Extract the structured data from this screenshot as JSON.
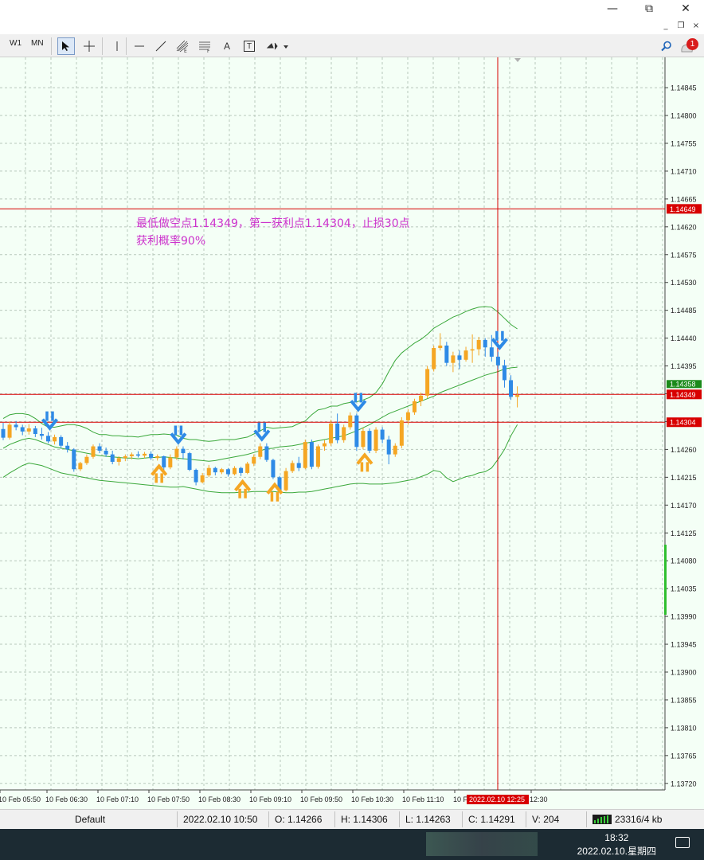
{
  "window": {
    "controls": {
      "minimize": "—",
      "maximize": "⧉",
      "close": "✕"
    },
    "mdi_controls": {
      "minimize": "_",
      "restore": "❐",
      "close": "×"
    }
  },
  "toolbar": {
    "timeframes": [
      "W1",
      "MN"
    ],
    "tools": [
      "cursor-icon",
      "crosshair-icon",
      "vertical-line-icon",
      "horizontal-line-icon",
      "trendline-icon",
      "fibonacci-icon",
      "channel-icon",
      "text-icon",
      "text-label-icon",
      "arrows-icon"
    ],
    "text_tool_label": "A",
    "text_label_tool_label": "T",
    "notification_badge": "1"
  },
  "colors": {
    "background": "#f4fff6",
    "grid": "#b8c8bc",
    "bull": "#f5a623",
    "bear": "#2e8ae6",
    "band": "#3aa83a",
    "level_line": "#d80000",
    "annotation": "#cc33cc"
  },
  "annotation": {
    "line1": "最低做空点1.14349，第一获利点1.14304，止损30点",
    "line2": "获利概率90%"
  },
  "chart_data": {
    "type": "candlestick",
    "symbol_timeframe": "M5",
    "price_axis": {
      "ticks": [
        1.14845,
        1.148,
        1.14755,
        1.1471,
        1.14665,
        1.1462,
        1.14575,
        1.1453,
        1.14485,
        1.1444,
        1.14395,
        1.1435,
        1.14305,
        1.1426,
        1.14215,
        1.1417,
        1.14125,
        1.1408,
        1.14035,
        1.1399,
        1.13945,
        1.139,
        1.13855,
        1.1381,
        1.13765,
        1.1372
      ],
      "range": [
        1.13712,
        1.14867
      ]
    },
    "time_axis": {
      "labels": [
        "10 Feb 05:50",
        "10 Feb 06:30",
        "10 Feb 07:10",
        "10 Feb 07:50",
        "10 Feb 08:30",
        "10 Feb 09:10",
        "10 Feb 09:50",
        "10 Feb 10:30",
        "10 Feb 11:10",
        "10 F",
        "12:30"
      ],
      "crosshair_label": "2022.02.10 12:25"
    },
    "horizontal_levels": [
      {
        "price": 1.14649,
        "label": "1.14649"
      },
      {
        "price": 1.14349,
        "label": "1.14349"
      },
      {
        "price": 1.14304,
        "label": "1.14304"
      }
    ],
    "current_price_label": "1.14358",
    "candles": [
      [
        1.14293,
        1.14303,
        1.14275,
        1.14279
      ],
      [
        1.14279,
        1.14305,
        1.14276,
        1.143
      ],
      [
        1.143,
        1.14306,
        1.14291,
        1.14296
      ],
      [
        1.14296,
        1.143,
        1.14283,
        1.14289
      ],
      [
        1.14289,
        1.14301,
        1.14284,
        1.14294
      ],
      [
        1.14294,
        1.14298,
        1.1428,
        1.14285
      ],
      [
        1.14285,
        1.14295,
        1.14276,
        1.14282
      ],
      [
        1.14282,
        1.14288,
        1.1427,
        1.14273
      ],
      [
        1.14273,
        1.14284,
        1.14268,
        1.1428
      ],
      [
        1.1428,
        1.14283,
        1.14262,
        1.14266
      ],
      [
        1.14266,
        1.14272,
        1.14255,
        1.1426
      ],
      [
        1.1426,
        1.14262,
        1.14224,
        1.14228
      ],
      [
        1.14228,
        1.1424,
        1.14225,
        1.14238
      ],
      [
        1.14238,
        1.14252,
        1.14235,
        1.14248
      ],
      [
        1.14248,
        1.14268,
        1.14245,
        1.14265
      ],
      [
        1.14265,
        1.1427,
        1.14254,
        1.14258
      ],
      [
        1.14258,
        1.14263,
        1.14248,
        1.14252
      ],
      [
        1.14252,
        1.14258,
        1.14236,
        1.1424
      ],
      [
        1.1424,
        1.14249,
        1.14234,
        1.14246
      ],
      [
        1.14246,
        1.14252,
        1.14241,
        1.14249
      ],
      [
        1.14249,
        1.14255,
        1.14244,
        1.14252
      ],
      [
        1.14252,
        1.14257,
        1.14247,
        1.1425
      ],
      [
        1.1425,
        1.14256,
        1.14246,
        1.14253
      ],
      [
        1.14253,
        1.14257,
        1.14243,
        1.14246
      ],
      [
        1.14246,
        1.14252,
        1.14242,
        1.14249
      ],
      [
        1.14249,
        1.1425,
        1.14226,
        1.14231
      ],
      [
        1.14231,
        1.14252,
        1.14228,
        1.14247
      ],
      [
        1.14247,
        1.14265,
        1.14243,
        1.14261
      ],
      [
        1.14261,
        1.14265,
        1.14244,
        1.14254
      ],
      [
        1.14254,
        1.14256,
        1.14225,
        1.14227
      ],
      [
        1.14227,
        1.14229,
        1.14202,
        1.14207
      ],
      [
        1.14207,
        1.14222,
        1.14205,
        1.14218
      ],
      [
        1.14218,
        1.14235,
        1.14215,
        1.1423
      ],
      [
        1.1423,
        1.14232,
        1.14218,
        1.14223
      ],
      [
        1.14223,
        1.1423,
        1.1422,
        1.14228
      ],
      [
        1.14228,
        1.1423,
        1.14216,
        1.1422
      ],
      [
        1.1422,
        1.14233,
        1.14218,
        1.1423
      ],
      [
        1.1423,
        1.14232,
        1.14217,
        1.14222
      ],
      [
        1.14222,
        1.1424,
        1.1422,
        1.14237
      ],
      [
        1.14237,
        1.14252,
        1.14233,
        1.14248
      ],
      [
        1.14248,
        1.1427,
        1.14244,
        1.14265
      ],
      [
        1.14265,
        1.1427,
        1.1424,
        1.14243
      ],
      [
        1.14243,
        1.14245,
        1.14212,
        1.14215
      ],
      [
        1.14215,
        1.14217,
        1.1419,
        1.14194
      ],
      [
        1.14194,
        1.1423,
        1.14192,
        1.14225
      ],
      [
        1.14225,
        1.14242,
        1.14222,
        1.14238
      ],
      [
        1.14238,
        1.14248,
        1.14225,
        1.1423
      ],
      [
        1.1423,
        1.14276,
        1.14228,
        1.14272
      ],
      [
        1.14272,
        1.14276,
        1.14228,
        1.14232
      ],
      [
        1.14232,
        1.14268,
        1.14229,
        1.14265
      ],
      [
        1.14265,
        1.14275,
        1.14258,
        1.1427
      ],
      [
        1.1427,
        1.14308,
        1.14266,
        1.14302
      ],
      [
        1.14302,
        1.14318,
        1.1427,
        1.14275
      ],
      [
        1.14275,
        1.143,
        1.14271,
        1.14296
      ],
      [
        1.14296,
        1.1432,
        1.14292,
        1.14315
      ],
      [
        1.14315,
        1.14318,
        1.14258,
        1.14264
      ],
      [
        1.14264,
        1.14295,
        1.1426,
        1.1429
      ],
      [
        1.1429,
        1.14294,
        1.14254,
        1.14258
      ],
      [
        1.14258,
        1.14296,
        1.14254,
        1.14292
      ],
      [
        1.14292,
        1.14296,
        1.1427,
        1.14276
      ],
      [
        1.14276,
        1.14282,
        1.14236,
        1.14252
      ],
      [
        1.14252,
        1.1427,
        1.14248,
        1.14266
      ],
      [
        1.14266,
        1.14312,
        1.14262,
        1.14307
      ],
      [
        1.14307,
        1.14325,
        1.143,
        1.1432
      ],
      [
        1.1432,
        1.14342,
        1.14316,
        1.14338
      ],
      [
        1.14338,
        1.14352,
        1.1433,
        1.14347
      ],
      [
        1.14347,
        1.14395,
        1.14343,
        1.1439
      ],
      [
        1.1439,
        1.14428,
        1.14386,
        1.14424
      ],
      [
        1.14424,
        1.14448,
        1.1442,
        1.14428
      ],
      [
        1.14428,
        1.14434,
        1.14395,
        1.144
      ],
      [
        1.144,
        1.14418,
        1.14385,
        1.14412
      ],
      [
        1.14412,
        1.1442,
        1.1439,
        1.14405
      ],
      [
        1.14405,
        1.14426,
        1.14402,
        1.1442
      ],
      [
        1.1442,
        1.14446,
        1.144,
        1.14422
      ],
      [
        1.14422,
        1.14442,
        1.14412,
        1.14437
      ],
      [
        1.14437,
        1.1444,
        1.1441,
        1.14425
      ],
      [
        1.14425,
        1.14445,
        1.14402,
        1.1441
      ],
      [
        1.1441,
        1.14418,
        1.1439,
        1.14396
      ],
      [
        1.14396,
        1.14405,
        1.1436,
        1.14372
      ],
      [
        1.14372,
        1.1438,
        1.1434,
        1.14345
      ],
      [
        1.14345,
        1.14362,
        1.14328,
        1.14348
      ]
    ],
    "bands": {
      "upper": [
        1.1431,
        1.14316,
        1.14318,
        1.14318,
        1.14316,
        1.1431,
        1.14302,
        1.14296,
        1.14296,
        1.14298,
        1.143,
        1.143,
        1.14298,
        1.14294,
        1.14288,
        1.14284,
        1.14284,
        1.14282,
        1.14282,
        1.14281,
        1.14281,
        1.1428,
        1.14282,
        1.14284,
        1.14284,
        1.14285,
        1.14284,
        1.14283,
        1.14278,
        1.14276,
        1.14276,
        1.14274,
        1.14273,
        1.14274,
        1.14276,
        1.14276,
        1.14276,
        1.14278,
        1.1428,
        1.14285,
        1.1429,
        1.14296,
        1.14294,
        1.14295,
        1.14296,
        1.14297,
        1.14302,
        1.14306,
        1.14316,
        1.14324,
        1.14326,
        1.1433,
        1.1433,
        1.14334,
        1.14336,
        1.14337,
        1.1434,
        1.14344,
        1.14352,
        1.14366,
        1.14386,
        1.14404,
        1.14416,
        1.14424,
        1.14432,
        1.14438,
        1.14446,
        1.14456,
        1.14462,
        1.14468,
        1.14474,
        1.14478,
        1.14483,
        1.14487,
        1.1449,
        1.14491,
        1.1449,
        1.14482,
        1.14472,
        1.14462,
        1.14455
      ],
      "middle": [
        1.14262,
        1.14268,
        1.14272,
        1.14276,
        1.14278,
        1.14276,
        1.14272,
        1.14268,
        1.14264,
        1.14262,
        1.1426,
        1.14258,
        1.14256,
        1.14254,
        1.14252,
        1.1425,
        1.14249,
        1.14248,
        1.14247,
        1.14246,
        1.14246,
        1.14245,
        1.14246,
        1.14247,
        1.14247,
        1.14248,
        1.14247,
        1.14246,
        1.14245,
        1.14244,
        1.14243,
        1.14242,
        1.14241,
        1.14242,
        1.14244,
        1.14246,
        1.14248,
        1.1425,
        1.14252,
        1.14255,
        1.14258,
        1.14261,
        1.14262,
        1.14264,
        1.14265,
        1.14266,
        1.14268,
        1.1427,
        1.14272,
        1.14274,
        1.14276,
        1.14278,
        1.1428,
        1.14282,
        1.14286,
        1.1429,
        1.14295,
        1.143,
        1.14306,
        1.14312,
        1.14318,
        1.14322,
        1.14326,
        1.1433,
        1.14334,
        1.14338,
        1.14342,
        1.14346,
        1.14352,
        1.14356,
        1.1436,
        1.14364,
        1.14368,
        1.14372,
        1.14376,
        1.1438,
        1.14383,
        1.14386,
        1.1439,
        1.14392,
        1.14393
      ],
      "lower": [
        1.14215,
        1.14222,
        1.14228,
        1.14234,
        1.14238,
        1.14236,
        1.14234,
        1.1423,
        1.14226,
        1.14222,
        1.1422,
        1.14218,
        1.14216,
        1.14214,
        1.14212,
        1.1421,
        1.14209,
        1.14208,
        1.14207,
        1.14206,
        1.14205,
        1.14204,
        1.14203,
        1.14202,
        1.14201,
        1.142,
        1.14199,
        1.14199,
        1.142,
        1.14198,
        1.14196,
        1.14194,
        1.14192,
        1.14191,
        1.1419,
        1.1419,
        1.1419,
        1.14191,
        1.14191,
        1.14192,
        1.14192,
        1.14192,
        1.14192,
        1.14191,
        1.1419,
        1.1419,
        1.14191,
        1.14191,
        1.14192,
        1.14194,
        1.14196,
        1.14198,
        1.142,
        1.14202,
        1.14204,
        1.14205,
        1.14205,
        1.14204,
        1.14204,
        1.14204,
        1.14205,
        1.14206,
        1.14208,
        1.1421,
        1.14212,
        1.14216,
        1.1422,
        1.14226,
        1.14224,
        1.14214,
        1.14208,
        1.14212,
        1.14216,
        1.14218,
        1.14222,
        1.14224,
        1.1423,
        1.14244,
        1.1426,
        1.14282,
        1.143
      ]
    },
    "signals": [
      {
        "type": "sell",
        "index": 7
      },
      {
        "type": "buy",
        "index": 24
      },
      {
        "type": "sell",
        "index": 27
      },
      {
        "type": "buy",
        "index": 37
      },
      {
        "type": "sell",
        "index": 40
      },
      {
        "type": "buy",
        "index": 42
      },
      {
        "type": "sell",
        "index": 55
      },
      {
        "type": "buy",
        "index": 56
      },
      {
        "type": "sell",
        "index": 77
      }
    ]
  },
  "status": {
    "profile": "Default",
    "datetime": "2022.02.10 10:50",
    "open": "O: 1.14266",
    "high": "H: 1.14306",
    "low": "L: 1.14263",
    "close": "C: 1.14291",
    "volume": "V: 204",
    "traffic": "23316/4 kb"
  },
  "taskbar": {
    "time": "18:32",
    "date": "2022.02.10.星期四"
  }
}
